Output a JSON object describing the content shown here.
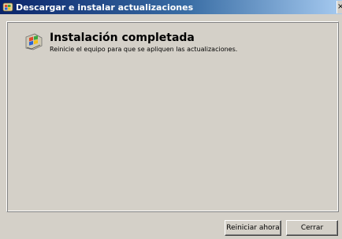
{
  "window": {
    "title": "Descargar e instalar actualizaciones"
  },
  "status": {
    "icon": "windows-update-icon",
    "heading": "Instalación completada",
    "message": "Reinicie el equipo para que se apliquen las actualizaciones."
  },
  "buttons": {
    "restart_label": "Reiniciar ahora",
    "close_label": "Cerrar"
  }
}
